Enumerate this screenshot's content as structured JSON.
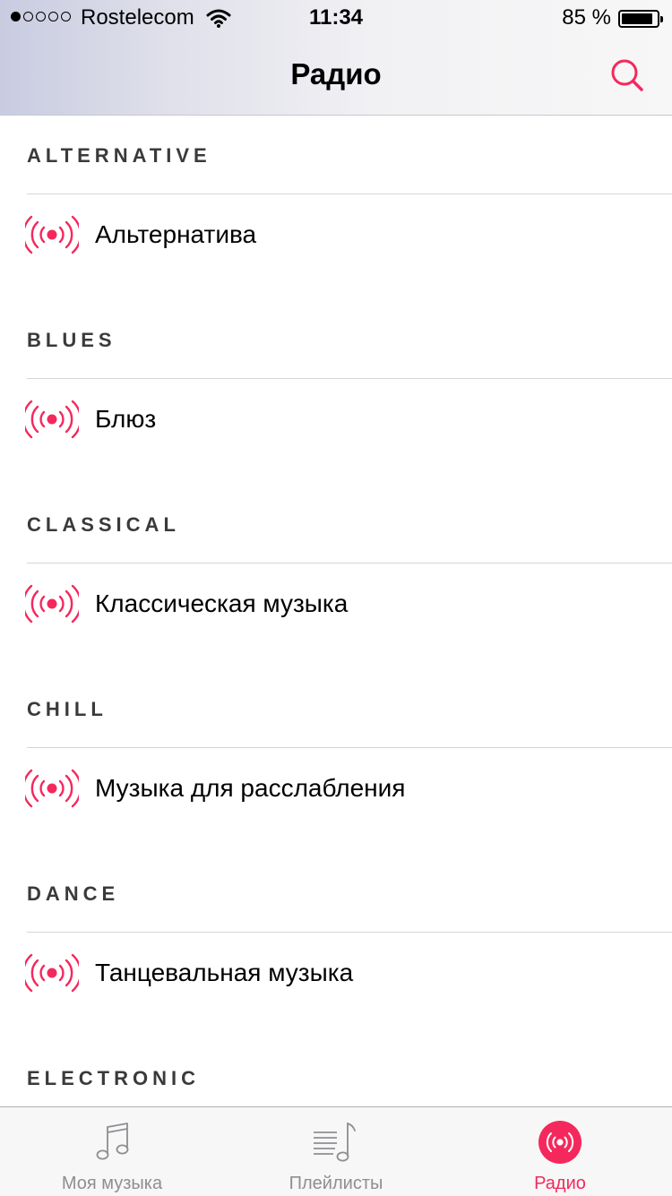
{
  "status_bar": {
    "carrier": "Rostelecom",
    "time": "11:34",
    "battery": "85 %",
    "signal_bars_filled": 1,
    "signal_bars_total": 5
  },
  "nav": {
    "title": "Радио",
    "search_icon": "search-icon",
    "accent_color": "#f5285d"
  },
  "sections": [
    {
      "header": "ALTERNATIVE",
      "station": "Альтернатива"
    },
    {
      "header": "BLUES",
      "station": "Блюз"
    },
    {
      "header": "CLASSICAL",
      "station": "Классическая музыка"
    },
    {
      "header": "CHILL",
      "station": "Музыка для расслабления"
    },
    {
      "header": "DANCE",
      "station": "Танцевальная музыка"
    },
    {
      "header": "ELECTRONIC",
      "station": ""
    }
  ],
  "tabbar": {
    "tabs": [
      {
        "label": "Моя музыка",
        "icon": "music-note-icon",
        "active": false
      },
      {
        "label": "Плейлисты",
        "icon": "playlist-icon",
        "active": false
      },
      {
        "label": "Радио",
        "icon": "radio-icon",
        "active": true
      }
    ]
  }
}
